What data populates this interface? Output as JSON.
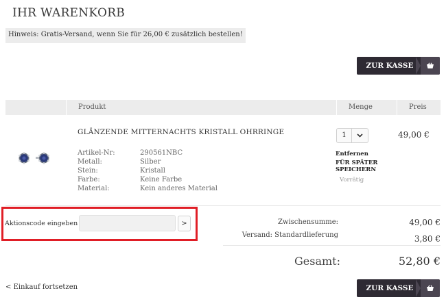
{
  "title": "IHR WARENKORB",
  "notice": "Hinweis: Gratis-Versand, wenn Sie für 26,00 € zusätzlich bestellen!",
  "checkout_button": {
    "label": "ZUR KASSE",
    "icon": "basket-icon"
  },
  "table": {
    "headers": {
      "product": "Produkt",
      "quantity": "Menge",
      "price": "Preis"
    }
  },
  "item": {
    "name": "GLÄNZENDE MITTERNACHTS KRISTALL OHRRINGE",
    "attributes": [
      {
        "label": "Artikel-Nr:",
        "value": "290561NBC"
      },
      {
        "label": "Metall:",
        "value": "Silber"
      },
      {
        "label": "Stein:",
        "value": "Kristall"
      },
      {
        "label": "Farbe:",
        "value": "Keine Farbe"
      },
      {
        "label": "Material:",
        "value": "Kein anderes Material"
      }
    ],
    "quantity": "1",
    "remove_label": "Entfernen",
    "save_later_label": "FÜR SPÄTER SPEICHERN",
    "stock_status": "Vorrätig",
    "price": "49,00 €"
  },
  "promo": {
    "label": "Aktionscode eingeben",
    "placeholder": "",
    "submit": ">"
  },
  "summary": {
    "subtotal_label": "Zwischensumme:",
    "subtotal_value": "49,00 €",
    "shipping_label": "Versand: Standardlieferung",
    "shipping_value": "3,80 €",
    "total_label": "Gesamt:",
    "total_value": "52,80 €"
  },
  "continue_shopping": "< Einkauf fortsetzen",
  "colors": {
    "button_bg": "#2e2a33",
    "highlight_frame": "#e01e26",
    "stone": "#2b3a7a"
  }
}
